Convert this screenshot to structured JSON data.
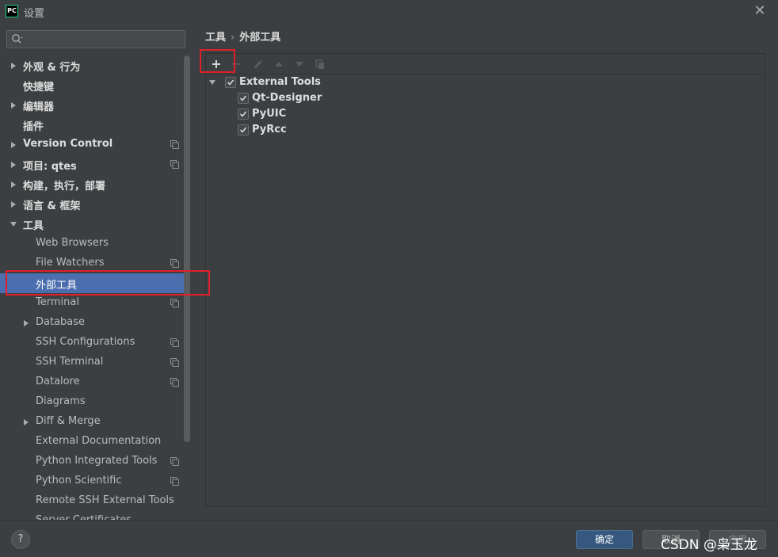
{
  "window": {
    "app_badge": "PC",
    "title": "设置",
    "close_symbol": "✕"
  },
  "search": {
    "value": "",
    "placeholder": ""
  },
  "sidebar": {
    "items": [
      {
        "label": "外观 & 行为",
        "bold": true,
        "level": 0,
        "arrow": "right",
        "copy": false
      },
      {
        "label": "快捷键",
        "bold": true,
        "level": 0,
        "arrow": "none",
        "copy": false
      },
      {
        "label": "编辑器",
        "bold": true,
        "level": 0,
        "arrow": "right",
        "copy": false
      },
      {
        "label": "插件",
        "bold": true,
        "level": 0,
        "arrow": "none",
        "copy": false
      },
      {
        "label": "Version Control",
        "bold": true,
        "level": 0,
        "arrow": "right",
        "copy": true
      },
      {
        "label": "项目: qtes",
        "bold": true,
        "level": 0,
        "arrow": "right",
        "copy": true
      },
      {
        "label": "构建，执行，部署",
        "bold": true,
        "level": 0,
        "arrow": "right",
        "copy": false
      },
      {
        "label": "语言 & 框架",
        "bold": true,
        "level": 0,
        "arrow": "right",
        "copy": false
      },
      {
        "label": "工具",
        "bold": true,
        "level": 0,
        "arrow": "down",
        "copy": false
      },
      {
        "label": "Web Browsers",
        "bold": false,
        "level": 1,
        "arrow": "none",
        "copy": false
      },
      {
        "label": "File Watchers",
        "bold": false,
        "level": 1,
        "arrow": "none",
        "copy": true
      },
      {
        "label": "外部工具",
        "bold": false,
        "level": 1,
        "arrow": "none",
        "copy": false,
        "selected": true
      },
      {
        "label": "Terminal",
        "bold": false,
        "level": 1,
        "arrow": "none",
        "copy": true
      },
      {
        "label": "Database",
        "bold": false,
        "level": 1,
        "arrow": "right",
        "copy": false
      },
      {
        "label": "SSH Configurations",
        "bold": false,
        "level": 1,
        "arrow": "none",
        "copy": true
      },
      {
        "label": "SSH Terminal",
        "bold": false,
        "level": 1,
        "arrow": "none",
        "copy": true
      },
      {
        "label": "Datalore",
        "bold": false,
        "level": 1,
        "arrow": "none",
        "copy": true
      },
      {
        "label": "Diagrams",
        "bold": false,
        "level": 1,
        "arrow": "none",
        "copy": false
      },
      {
        "label": "Diff & Merge",
        "bold": false,
        "level": 1,
        "arrow": "right",
        "copy": false
      },
      {
        "label": "External Documentation",
        "bold": false,
        "level": 1,
        "arrow": "none",
        "copy": false
      },
      {
        "label": "Python Integrated Tools",
        "bold": false,
        "level": 1,
        "arrow": "none",
        "copy": true
      },
      {
        "label": "Python Scientific",
        "bold": false,
        "level": 1,
        "arrow": "none",
        "copy": true
      },
      {
        "label": "Remote SSH External Tools",
        "bold": false,
        "level": 1,
        "arrow": "none",
        "copy": false
      },
      {
        "label": "Server Certificates",
        "bold": false,
        "level": 1,
        "arrow": "none",
        "copy": false
      }
    ]
  },
  "breadcrumb": {
    "parent": "工具",
    "separator": "›",
    "current": "外部工具"
  },
  "toolbar": {
    "add": "+",
    "remove": "−",
    "edit": "edit-icon",
    "move_up": "up-icon",
    "move_down": "down-icon",
    "copy": "copy-icon"
  },
  "external_tools": {
    "group": {
      "label": "External Tools",
      "checked": true
    },
    "items": [
      {
        "label": "Qt-Designer",
        "checked": true
      },
      {
        "label": "PyUIC",
        "checked": true
      },
      {
        "label": "PyRcc",
        "checked": true
      }
    ]
  },
  "footer": {
    "help": "?",
    "ok": "确定",
    "cancel": "取消",
    "apply": "应用",
    "watermark": "CSDN @枭玉龙"
  },
  "colors": {
    "selection": "#4b6eaf",
    "highlight_box": "#e0202a",
    "ok_button": "#365880"
  }
}
